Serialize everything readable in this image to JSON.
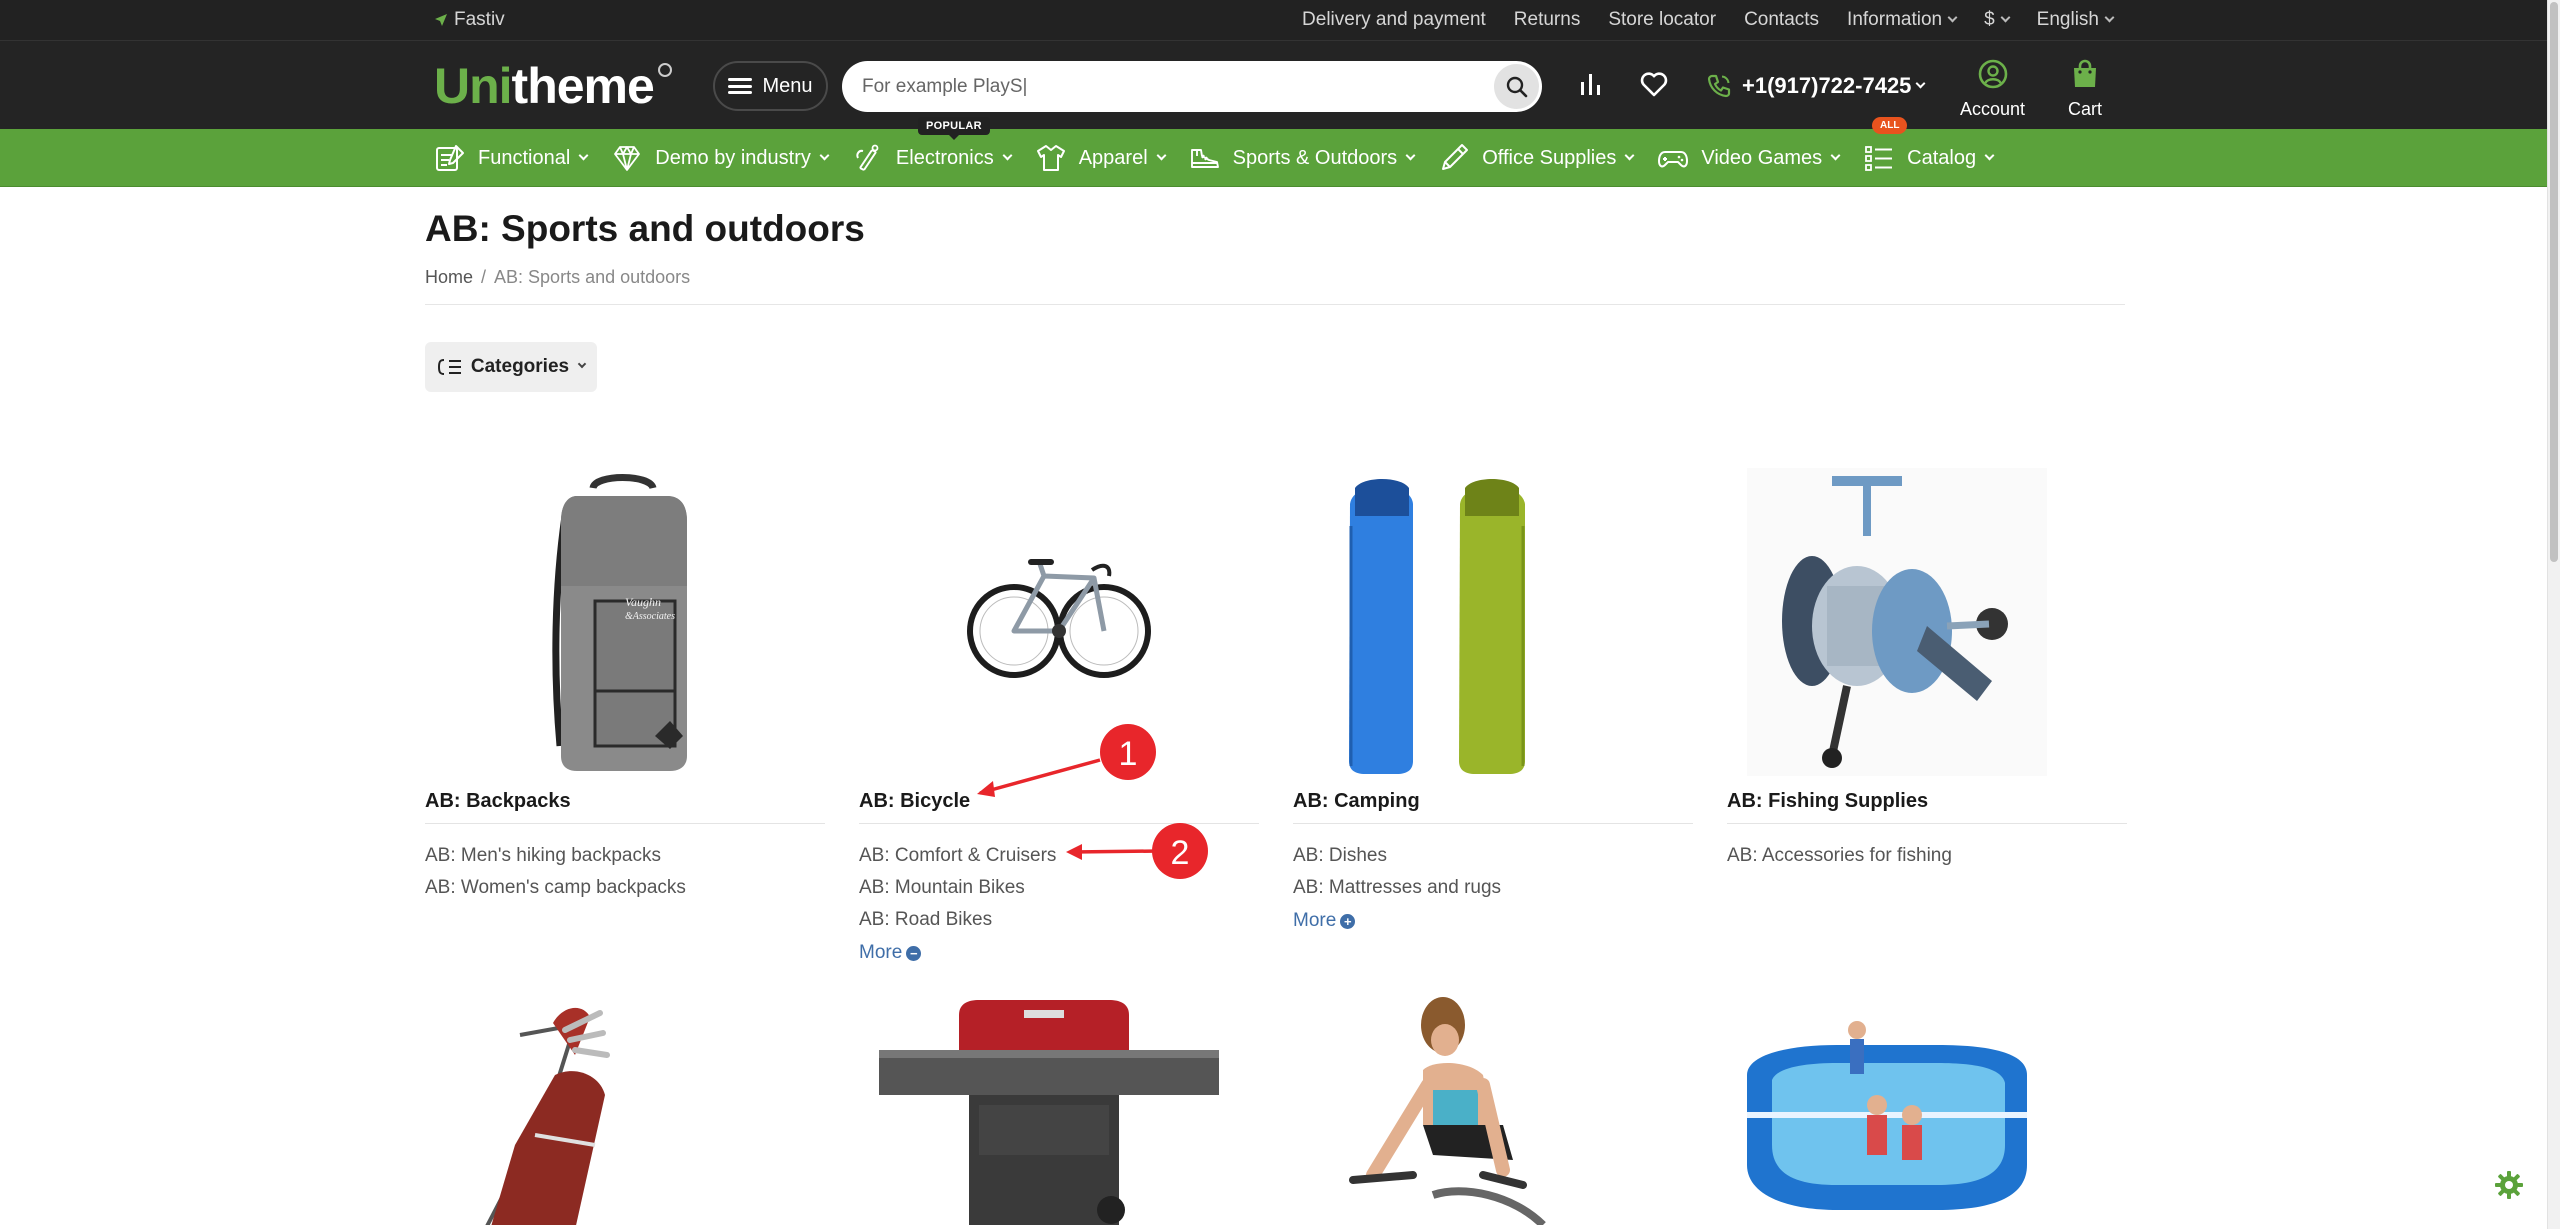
{
  "topbar": {
    "city": "Fastiv",
    "links": [
      "Delivery and payment",
      "Returns",
      "Store locator",
      "Contacts"
    ],
    "information": "Information",
    "currency": "$",
    "language": "English"
  },
  "header": {
    "logo_accent": "Uni",
    "logo_rest": "theme",
    "menu_label": "Menu",
    "search_placeholder": "For example PlayS|",
    "phone": "+1(917)722-7425",
    "account_label": "Account",
    "cart_label": "Cart"
  },
  "nav": {
    "items": [
      {
        "label": "Functional",
        "icon": "functional-icon"
      },
      {
        "label": "Demo by industry",
        "icon": "diamond-icon"
      },
      {
        "label": "Electronics",
        "icon": "electronics-icon"
      },
      {
        "label": "Apparel",
        "icon": "shirt-icon"
      },
      {
        "label": "Sports & Outdoors",
        "icon": "shoe-icon"
      },
      {
        "label": "Office Supplies",
        "icon": "pen-icon"
      },
      {
        "label": "Video Games",
        "icon": "gamepad-icon"
      },
      {
        "label": "Catalog",
        "icon": "list-icon"
      }
    ],
    "badge_popular": "POPULAR",
    "badge_all": "ALL"
  },
  "page": {
    "title": "AB: Sports and outdoors",
    "breadcrumb_home": "Home",
    "breadcrumb_sep": "/",
    "breadcrumb_current": "AB: Sports and outdoors",
    "categories_button": "Categories"
  },
  "cards": [
    {
      "title": "AB: Backpacks",
      "items": [
        "AB: Men's hiking backpacks",
        "AB: Women's camp backpacks"
      ],
      "more": ""
    },
    {
      "title": "AB: Bicycle",
      "items": [
        "AB: Comfort & Cruisers",
        "AB: Mountain Bikes",
        "AB: Road Bikes"
      ],
      "more": "More"
    },
    {
      "title": "AB: Camping",
      "items": [
        "AB: Dishes",
        "AB: Mattresses and rugs"
      ],
      "more": "More"
    },
    {
      "title": "AB: Fishing Supplies",
      "items": [
        "AB: Accessories for fishing"
      ],
      "more": ""
    }
  ],
  "annotations": [
    "1",
    "2"
  ],
  "colors": {
    "brand_green": "#5ba23b",
    "dark": "#242424",
    "link_blue": "#3f6ea8",
    "annotation_red": "#e8262b",
    "badge_orange": "#e8531e"
  }
}
